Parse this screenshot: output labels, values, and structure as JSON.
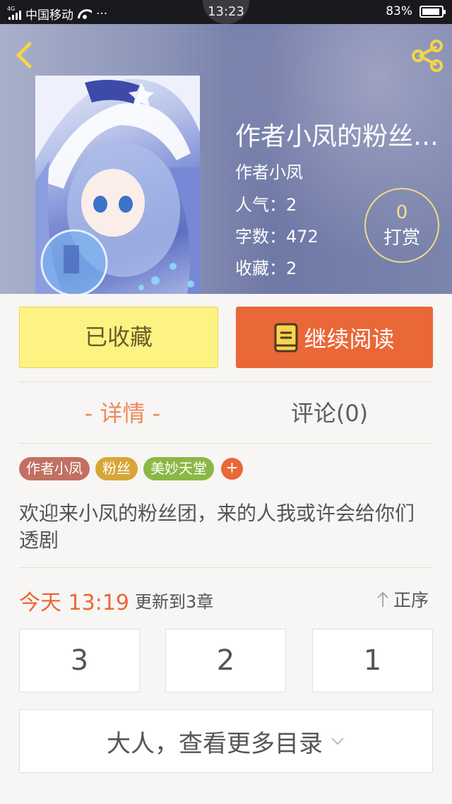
{
  "status_bar": {
    "network_type": "4G",
    "carrier": "中国移动",
    "more_indicator": "···",
    "time": "13:23",
    "battery_text": "83%",
    "battery_level": 0.83
  },
  "header": {
    "back_icon": "chevron-left-icon",
    "share_icon": "share-icon",
    "accent_color": "#f4d547"
  },
  "book": {
    "title": "作者小凤的粉丝…",
    "author": "作者小凤",
    "popularity": "人气：2",
    "word_count": "字数：472",
    "favorites": "收藏：2",
    "tip_count": "0",
    "tip_label": "打赏"
  },
  "actions": {
    "favorite_label": "已收藏",
    "read_label": "继续阅读",
    "read_icon": "book-icon"
  },
  "tabs": {
    "detail": "- 详情 -",
    "comments": "评论(0)"
  },
  "tags": [
    "作者小凤",
    "粉丝",
    "美妙天堂"
  ],
  "tag_add": "+",
  "description": "欢迎来小凤的粉丝团，来的人我或许会给你们透剧",
  "update": {
    "time": "今天 13:19",
    "text": "更新到3章",
    "sort_label": "正序",
    "sort_icon": "arrow-up-icon"
  },
  "chapters": [
    "3",
    "2",
    "1"
  ],
  "more_label": "大人，查看更多目录",
  "more_icon": "chevron-down-icon",
  "colors": {
    "orange": "#ea6737",
    "yellow_button": "#fcf383",
    "tab_active": "#ee8a5a"
  }
}
